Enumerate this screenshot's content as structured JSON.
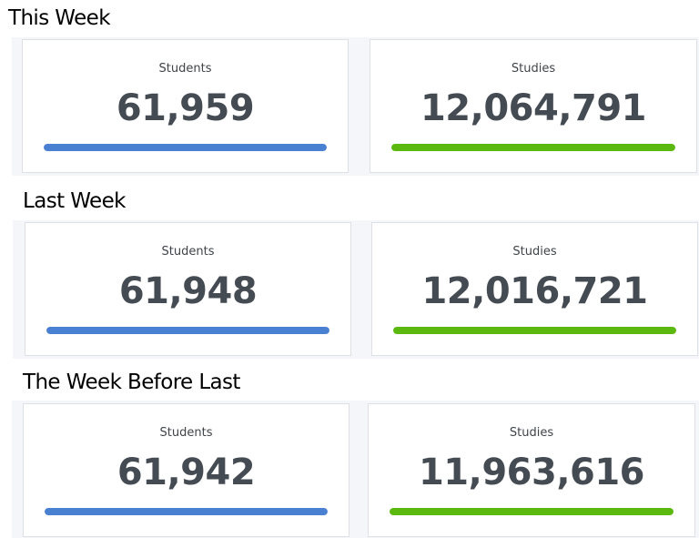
{
  "colors": {
    "students_bar": "#4a80d2",
    "studies_bar": "#5ab80f"
  },
  "periods": [
    {
      "title": "This Week",
      "students": {
        "label": "Students",
        "value": "61,959",
        "progress": 1.0
      },
      "studies": {
        "label": "Studies",
        "value": "12,064,791",
        "progress": 1.0
      }
    },
    {
      "title": "Last Week",
      "students": {
        "label": "Students",
        "value": "61,948",
        "progress": 1.0
      },
      "studies": {
        "label": "Studies",
        "value": "12,016,721",
        "progress": 1.0
      }
    },
    {
      "title": "The Week Before Last",
      "students": {
        "label": "Students",
        "value": "61,942",
        "progress": 1.0
      },
      "studies": {
        "label": "Studies",
        "value": "11,963,616",
        "progress": 1.0
      }
    }
  ]
}
